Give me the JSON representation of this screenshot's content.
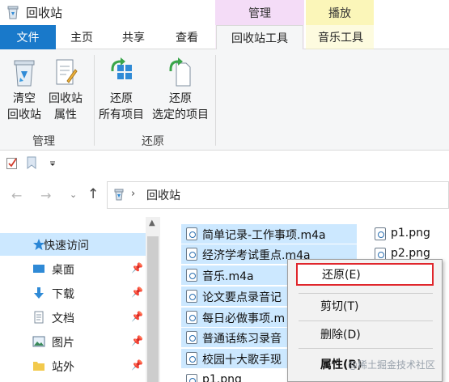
{
  "window": {
    "title": "回收站"
  },
  "context_tabs": {
    "management": "管理",
    "playback": "播放"
  },
  "tabs": [
    {
      "label": "文件"
    },
    {
      "label": "主页"
    },
    {
      "label": "共享"
    },
    {
      "label": "查看"
    },
    {
      "label": "回收站工具"
    },
    {
      "label": "音乐工具"
    }
  ],
  "ribbon": {
    "groups": [
      {
        "label": "管理",
        "buttons": [
          {
            "line1": "清空",
            "line2": "回收站"
          },
          {
            "line1": "回收站",
            "line2": "属性"
          }
        ]
      },
      {
        "label": "还原",
        "buttons": [
          {
            "line1": "还原",
            "line2": "所有项目"
          },
          {
            "line1": "还原",
            "line2": "选定的项目"
          }
        ]
      }
    ]
  },
  "address": {
    "path": "回收站"
  },
  "nav": {
    "items": [
      {
        "label": "快速访问"
      },
      {
        "label": "桌面"
      },
      {
        "label": "下载"
      },
      {
        "label": "文档"
      },
      {
        "label": "图片"
      },
      {
        "label": "站外"
      }
    ]
  },
  "files": {
    "col1": [
      "简单记录-工作事项.m4a",
      "经济学考试重点.m4a",
      "音乐.m4a",
      "论文要点录音记",
      "每日必做事项.m",
      "普通话练习录音",
      "校园十大歌手现",
      "p1.png"
    ],
    "col2": [
      "p1.png",
      "p2.png"
    ]
  },
  "context_menu": {
    "items": [
      "还原(E)",
      "剪切(T)",
      "删除(D)",
      "属性(R)"
    ]
  },
  "watermark": "@稀土掘金技术社区"
}
